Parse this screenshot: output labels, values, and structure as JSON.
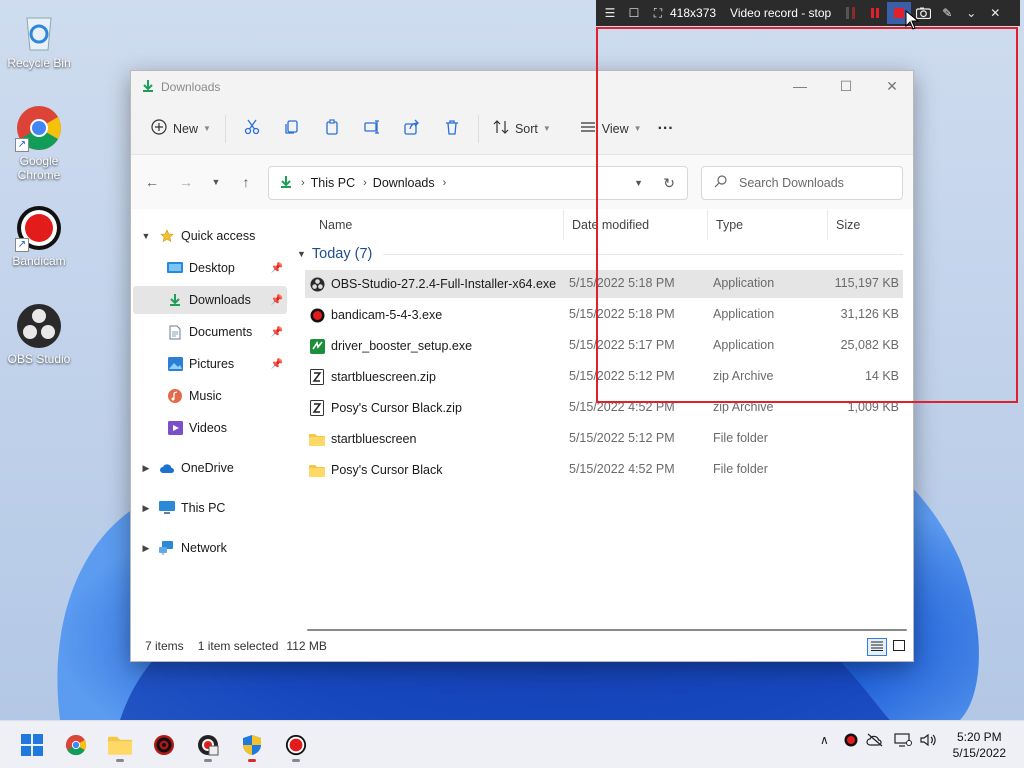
{
  "desktop": {
    "icons": [
      {
        "label": "Recycle Bin"
      },
      {
        "label": "Google Chrome"
      },
      {
        "label": "Bandicam"
      },
      {
        "label": "OBS Studio"
      }
    ]
  },
  "window": {
    "title": "Downloads",
    "controls": {
      "minimize": "—",
      "maximize": "☐",
      "close": "✕"
    }
  },
  "commandbar": {
    "new_label": "New",
    "sort_label": "Sort",
    "view_label": "View",
    "more_label": "···"
  },
  "address": {
    "crumbs": [
      "This PC",
      "Downloads"
    ],
    "search_placeholder": "Search Downloads"
  },
  "navpane": {
    "items": [
      {
        "label": "Quick access"
      },
      {
        "label": "Desktop"
      },
      {
        "label": "Downloads"
      },
      {
        "label": "Documents"
      },
      {
        "label": "Pictures"
      },
      {
        "label": "Music"
      },
      {
        "label": "Videos"
      },
      {
        "label": "OneDrive"
      },
      {
        "label": "This PC"
      },
      {
        "label": "Network"
      }
    ]
  },
  "filelist": {
    "columns": [
      "Name",
      "Date modified",
      "Type",
      "Size"
    ],
    "group_label": "Today (7)",
    "rows": [
      {
        "name": "OBS-Studio-27.2.4-Full-Installer-x64.exe",
        "date": "5/15/2022 5:18 PM",
        "type": "Application",
        "size": "115,197 KB",
        "icon": "obs-app-icon"
      },
      {
        "name": "bandicam-5-4-3.exe",
        "date": "5/15/2022 5:18 PM",
        "type": "Application",
        "size": "31,126 KB",
        "icon": "bandicam-app-icon"
      },
      {
        "name": "driver_booster_setup.exe",
        "date": "5/15/2022 5:17 PM",
        "type": "Application",
        "size": "25,082 KB",
        "icon": "driver-booster-icon"
      },
      {
        "name": "startbluescreen.zip",
        "date": "5/15/2022 5:12 PM",
        "type": "zip Archive",
        "size": "14 KB",
        "icon": "zip-icon"
      },
      {
        "name": "Posy's Cursor Black.zip",
        "date": "5/15/2022 4:52 PM",
        "type": "zip Archive",
        "size": "1,009 KB",
        "icon": "zip-icon"
      },
      {
        "name": "startbluescreen",
        "date": "5/15/2022 5:12 PM",
        "type": "File folder",
        "size": "",
        "icon": "folder-icon"
      },
      {
        "name": "Posy's Cursor Black",
        "date": "5/15/2022 4:52 PM",
        "type": "File folder",
        "size": "",
        "icon": "folder-icon"
      }
    ]
  },
  "statusbar": {
    "item_count": "7 items",
    "selection": "1 item selected",
    "selection_size": "112 MB"
  },
  "recorder": {
    "region_size": "418x373",
    "status": "Video record - stop",
    "accent_color": "#e0202a"
  },
  "taskbar": {
    "time": "5:20 PM",
    "date": "5/15/2022"
  }
}
